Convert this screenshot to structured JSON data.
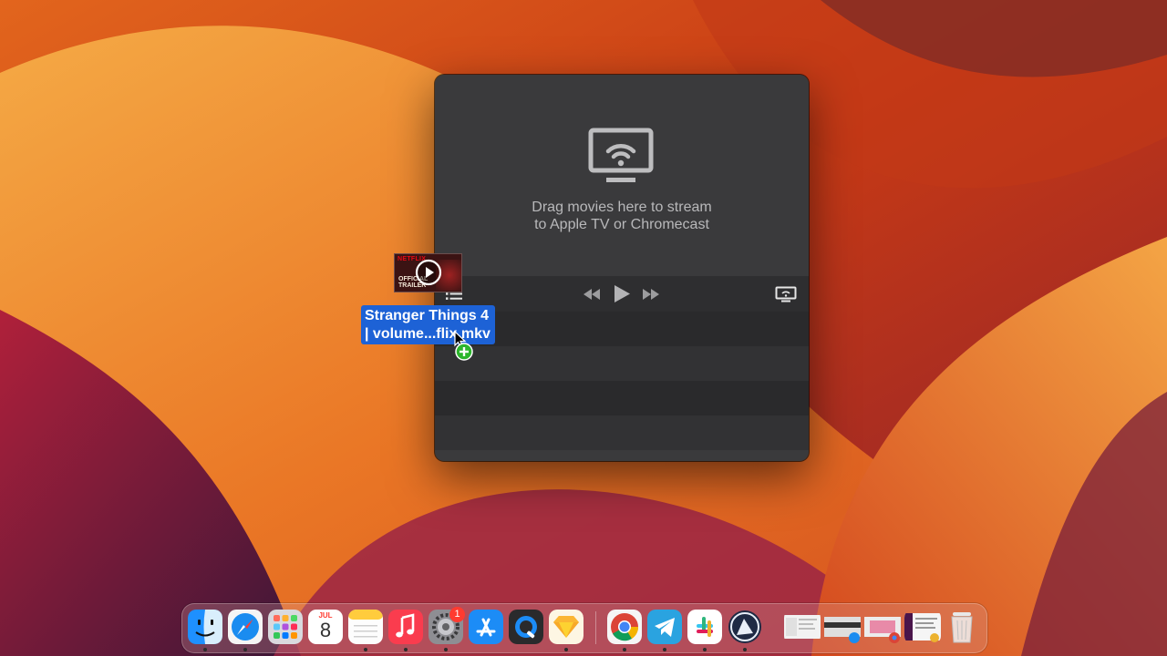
{
  "window": {
    "drop_text_line1": "Drag movies here to stream",
    "drop_text_line2": "to Apple TV or Chromecast"
  },
  "drag": {
    "thumbnail_brand": "NETFLIX",
    "thumbnail_caption": "OFFICIAL TRAILER",
    "filename_line1": "Stranger Things 4",
    "filename_line2": "| volume...flix.mkv"
  },
  "dock": {
    "apps": [
      "finder",
      "safari",
      "launchpad",
      "calendar",
      "notes",
      "music",
      "system-settings",
      "app-store",
      "quicktime",
      "sketch",
      "chrome",
      "telegram",
      "slack",
      "proxyman"
    ],
    "calendar_month": "JUL",
    "calendar_day": "8",
    "settings_badge": "1"
  },
  "colors": {
    "window_bg": "#3a3a3c",
    "selection_blue": "#1d62d6",
    "badge_red": "#ff3b30"
  }
}
